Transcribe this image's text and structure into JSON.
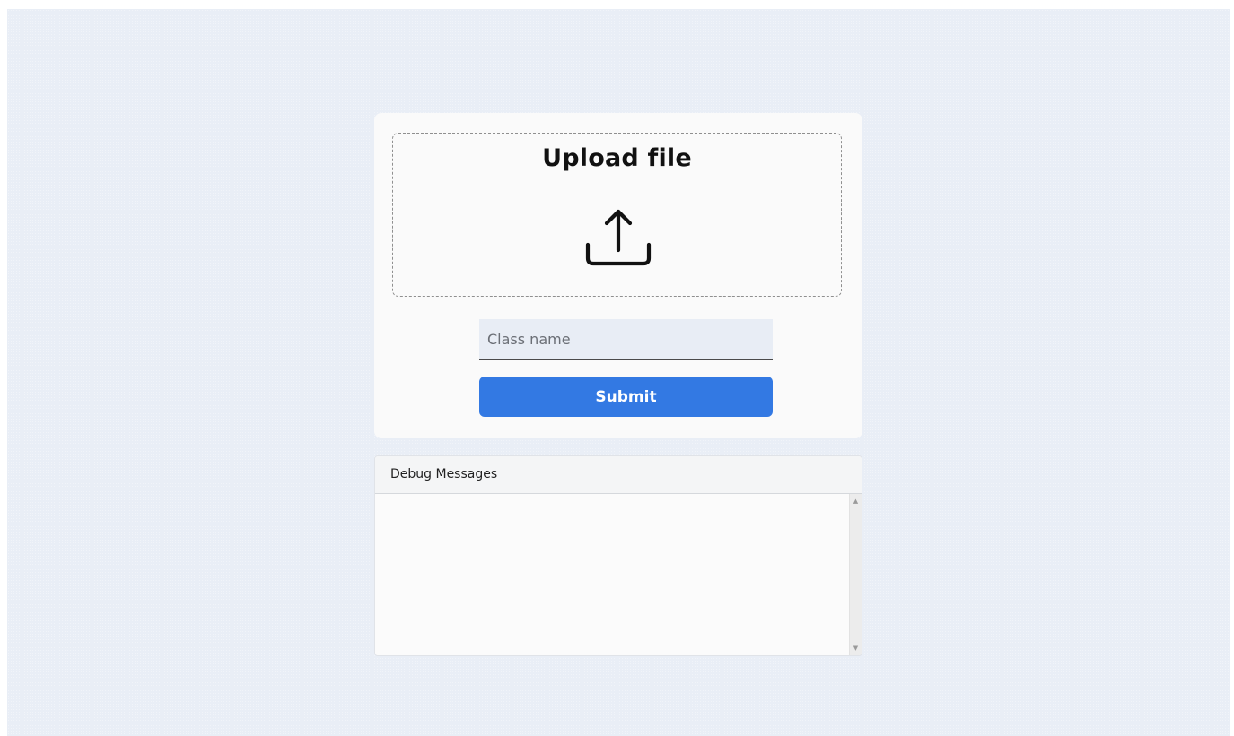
{
  "upload": {
    "title": "Upload file",
    "icon": "upload-icon"
  },
  "form": {
    "class_name_placeholder": "Class name",
    "class_name_value": "",
    "submit_label": "Submit"
  },
  "debug": {
    "title": "Debug Messages",
    "content": ""
  },
  "colors": {
    "background": "#e9eef6",
    "card": "#fafafa",
    "accent": "#3379e3",
    "input_bg": "#e8edf5"
  }
}
